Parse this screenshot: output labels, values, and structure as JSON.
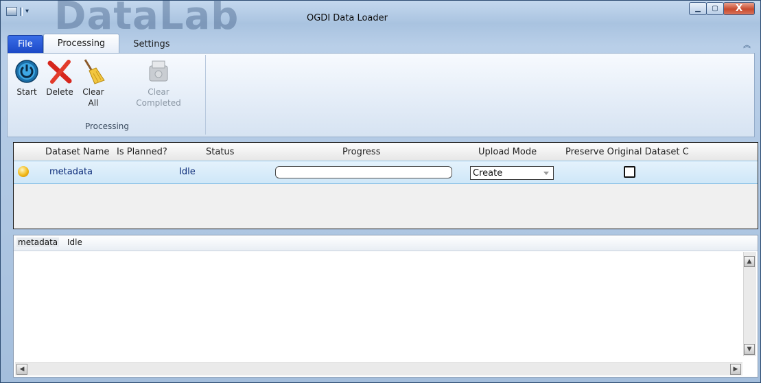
{
  "window": {
    "title": "OGDI Data Loader",
    "watermark": "DataLab",
    "minimize_icon": "minimize-icon",
    "maximize_icon": "maximize-icon",
    "close_label": "X"
  },
  "ribbon": {
    "tabs": [
      {
        "label": "File"
      },
      {
        "label": "Processing"
      },
      {
        "label": "Settings"
      }
    ],
    "group_label": "Processing",
    "buttons": {
      "start": "Start",
      "delete": "Delete",
      "clear_all_1": "Clear",
      "clear_all_2": "All",
      "clear_completed_1": "Clear",
      "clear_completed_2": "Completed"
    }
  },
  "grid": {
    "headers": {
      "dataset_name": "Dataset Name",
      "is_planned": "Is Planned?",
      "status": "Status",
      "progress": "Progress",
      "upload_mode": "Upload Mode",
      "preserve": "Preserve Original Dataset C"
    },
    "rows": [
      {
        "dataset_name": "metadata",
        "status": "Idle",
        "progress_fraction": 0,
        "upload_mode": "Create",
        "preserve_checked": false
      }
    ]
  },
  "log_panel": {
    "dataset": "metadata",
    "status": "Idle"
  },
  "colors": {
    "file_tab": "#1c49c7",
    "selected_row": "#cfe7f8",
    "row_text": "#0a2a78"
  }
}
